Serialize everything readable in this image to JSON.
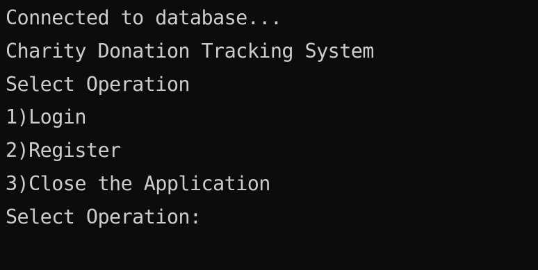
{
  "terminal": {
    "lines": [
      "Connected to database...",
      "Charity Donation Tracking System",
      "Select Operation",
      "1)Login",
      "2)Register",
      "3)Close the Application"
    ],
    "prompt": "Select Operation:",
    "input_value": ""
  },
  "colors": {
    "background": "#0c0c0c",
    "foreground": "#cccccc"
  }
}
